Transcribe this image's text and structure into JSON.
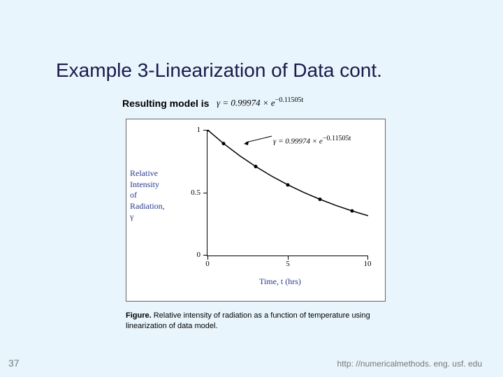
{
  "title": "Example 3-Linearization of Data cont.",
  "resulting_label": "Resulting model is",
  "equation_html": "γ = 0.99974 × e<span class='sup'>−0.11505t</span>",
  "chart_data": {
    "type": "line",
    "title": "",
    "xlabel": "Time, t (hrs)",
    "ylabel_lines": [
      "Relative",
      "Intensity",
      "of",
      "Radiation,",
      "γ"
    ],
    "xlim": [
      0,
      10
    ],
    "ylim": [
      0,
      1
    ],
    "xticks": [
      0,
      5,
      10
    ],
    "yticks": [
      0,
      0.5,
      1
    ],
    "series": [
      {
        "name": "fit",
        "x": [
          0,
          1,
          2,
          3,
          4,
          5,
          6,
          7,
          8,
          9,
          10
        ],
        "y": [
          0.99974,
          0.8912,
          0.7944,
          0.7081,
          0.6312,
          0.5626,
          0.5015,
          0.447,
          0.3984,
          0.3552,
          0.3166
        ]
      }
    ],
    "points": {
      "x": [
        0,
        1,
        3,
        5,
        7,
        9
      ],
      "y": [
        1.0,
        0.891,
        0.708,
        0.562,
        0.447,
        0.355
      ]
    },
    "annotation": "γ = 0.99974 × e<span class='sup'>−0.11505t</span>"
  },
  "caption_prefix": "Figure.",
  "caption_text": " Relative intensity of radiation as a function of temperature using linearization of data model.",
  "page_number": "37",
  "url": "http: //numericalmethods. eng. usf. edu"
}
